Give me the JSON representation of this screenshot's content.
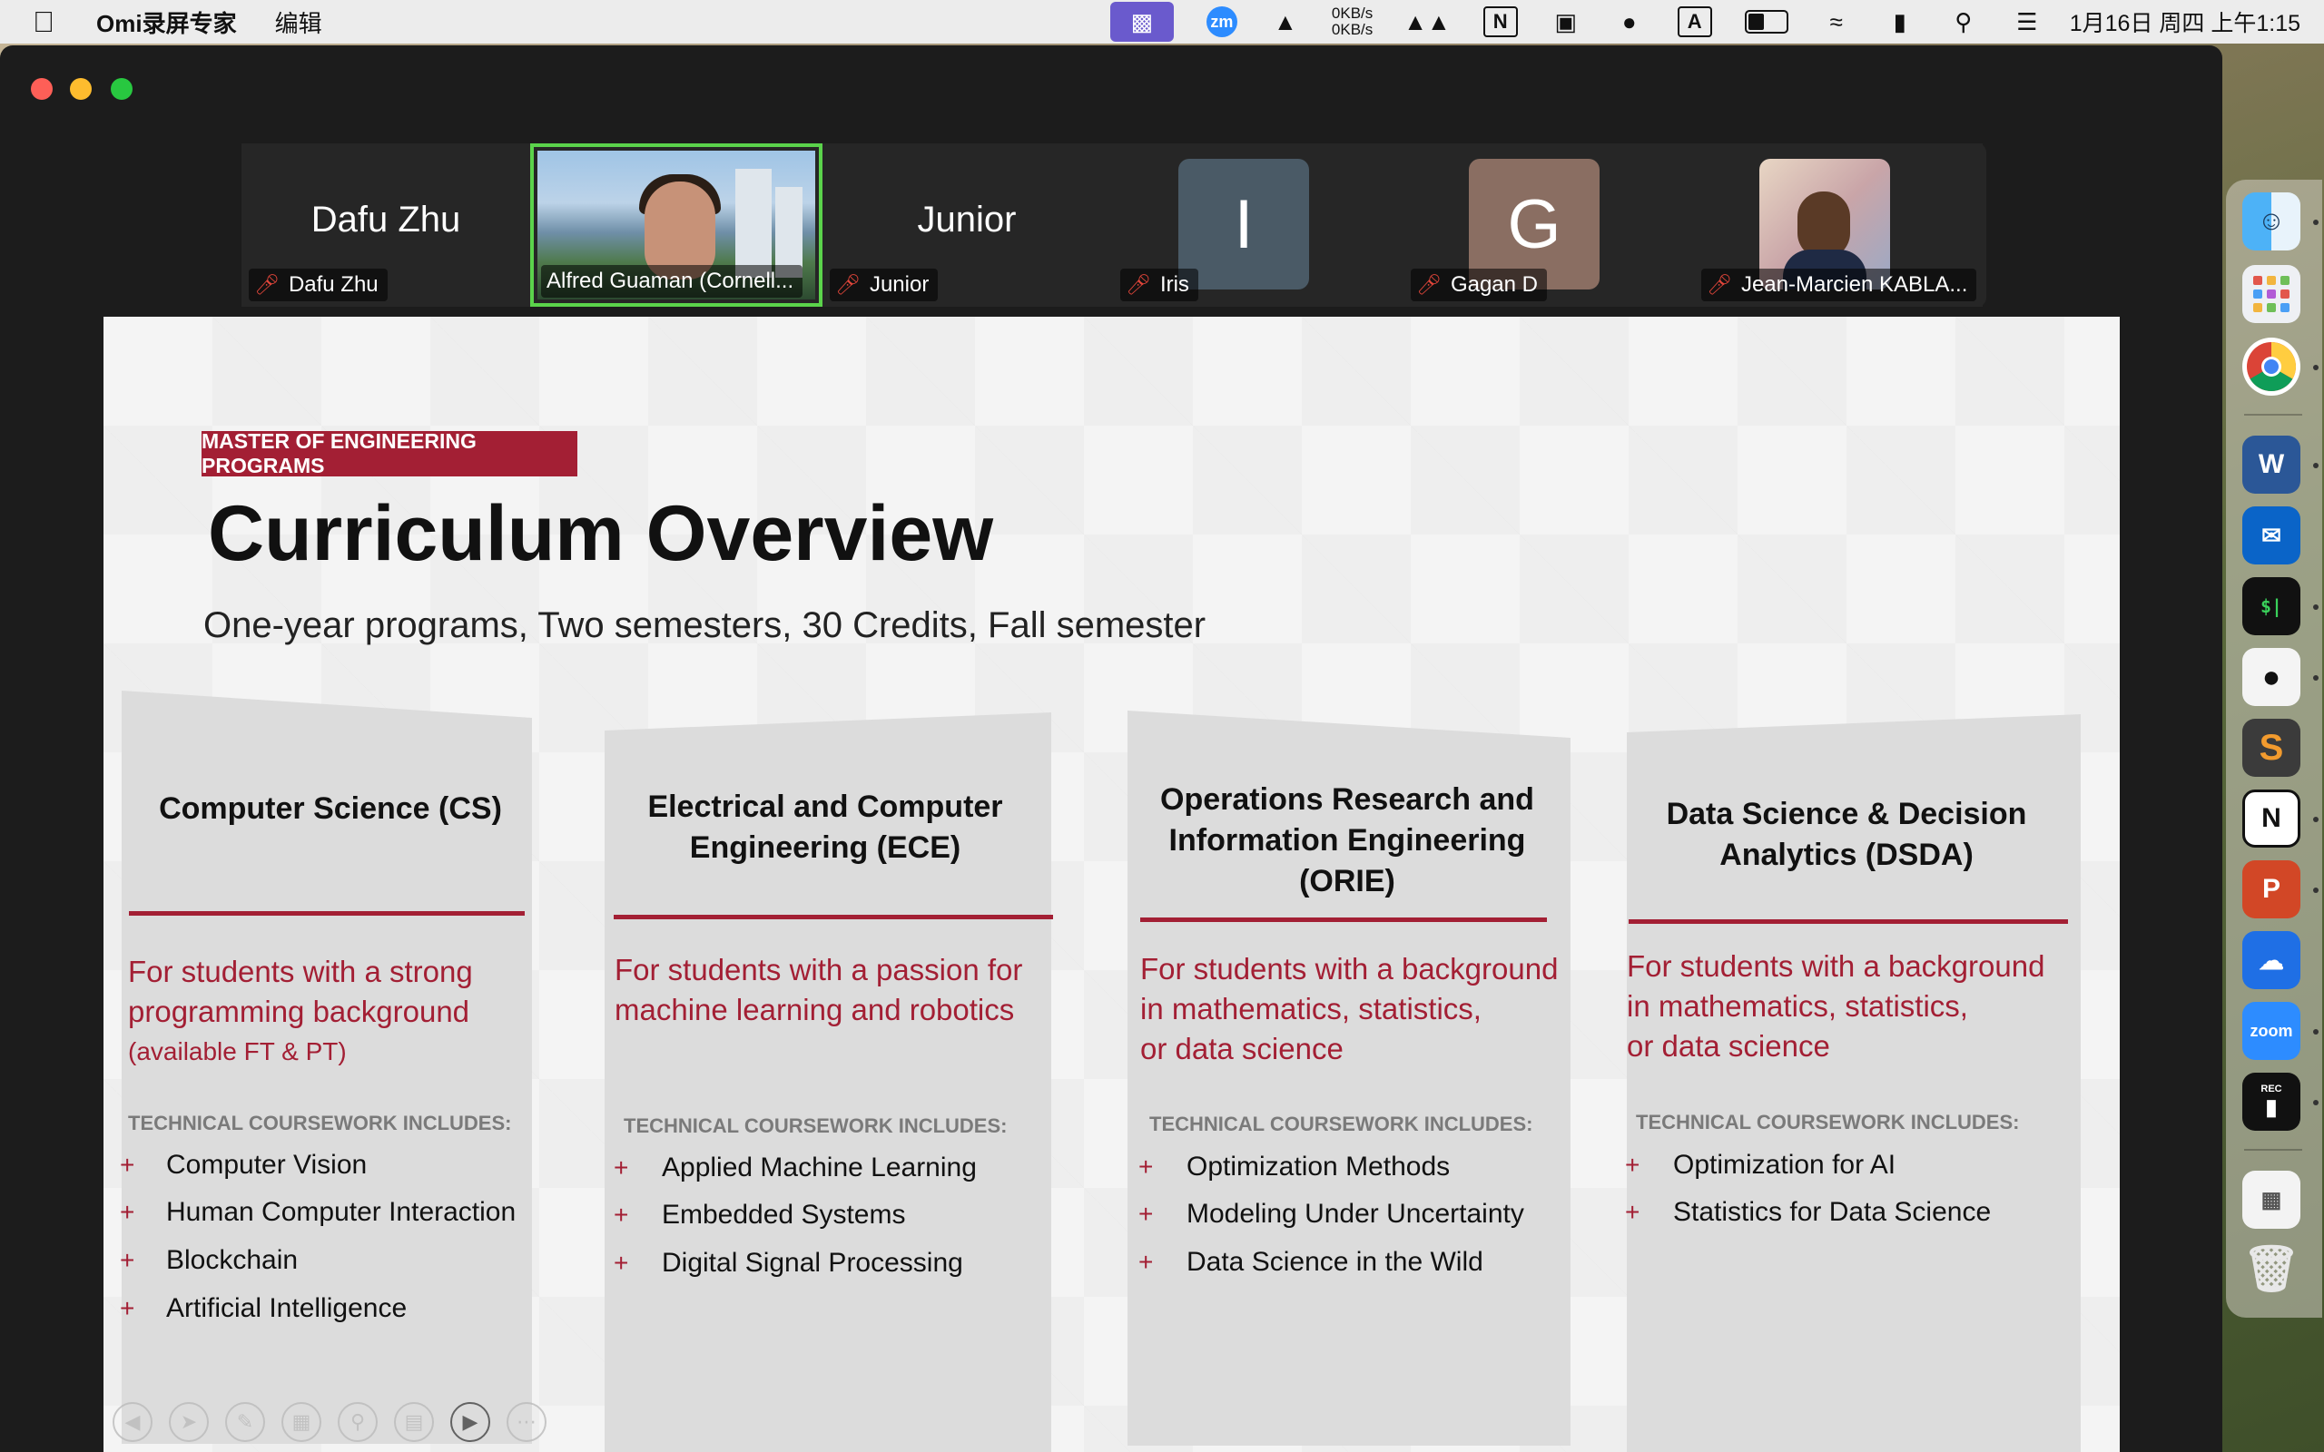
{
  "menubar": {
    "app_name": "Omi录屏专家",
    "menu_edit": "编辑",
    "network_up": "0KB/s",
    "network_down": "0KB/s",
    "zm_label": "zm",
    "notion_label": "N",
    "font_label": "A",
    "clock": "1月16日 周四  上午1:15"
  },
  "meeting": {
    "participants": [
      {
        "big_name": "Dafu Zhu",
        "label": "Dafu Zhu",
        "muted": true
      },
      {
        "big_name": "",
        "label": "Alfred Guaman (Cornell...",
        "muted": false,
        "video": true
      },
      {
        "big_name": "Junior",
        "label": "Junior",
        "muted": true
      },
      {
        "avatar_letter": "I",
        "label": "Iris",
        "muted": true,
        "avatar_color": "#4a5a66"
      },
      {
        "avatar_letter": "G",
        "label": "Gagan D",
        "muted": true,
        "avatar_color": "#8a6e62"
      },
      {
        "label": "Jean-Marcien KABLA...",
        "muted": true,
        "photo": true
      }
    ]
  },
  "slide": {
    "tag": "MASTER OF ENGINEERING PROGRAMS",
    "title": "Curriculum Overview",
    "subtitle": "One-year programs, Two semesters, 30 Credits, Fall semester",
    "accent_color": "#a31f34",
    "columns": [
      {
        "title_lines": [
          "Computer Science (CS)"
        ],
        "desc_lines": [
          "For students with a strong",
          "programming background"
        ],
        "desc_small": "(available FT & PT)",
        "coursework_heading": "TECHNICAL COURSEWORK INCLUDES:",
        "courses": [
          "Computer Vision",
          "Human Computer Interaction",
          "Blockchain",
          "Artificial Intelligence"
        ]
      },
      {
        "title_lines": [
          "Electrical and Computer",
          "Engineering (ECE)"
        ],
        "desc_lines": [
          "For students with a passion for",
          "machine learning and robotics"
        ],
        "coursework_heading": "TECHNICAL COURSEWORK INCLUDES:",
        "courses": [
          "Applied Machine Learning",
          "Embedded Systems",
          "Digital Signal Processing"
        ]
      },
      {
        "title_lines": [
          "Operations Research and",
          "Information Engineering",
          "(ORIE)"
        ],
        "desc_lines": [
          "For students with a background",
          "in mathematics, statistics,",
          "or data science"
        ],
        "coursework_heading": "TECHNICAL COURSEWORK INCLUDES:",
        "courses": [
          "Optimization Methods",
          "Modeling Under Uncertainty",
          "Data Science in the Wild"
        ]
      },
      {
        "title_lines": [
          "Data Science & Decision",
          "Analytics  (DSDA)"
        ],
        "desc_lines": [
          "For students with a background",
          "in mathematics, statistics,",
          "or data science"
        ],
        "coursework_heading": "TECHNICAL COURSEWORK INCLUDES:",
        "courses": [
          "Optimization for AI",
          "Statistics for Data Science"
        ]
      }
    ]
  },
  "dock": {
    "word_label": "W",
    "notion_label": "N",
    "ppt_label": "P",
    "zoom_label": "zoom",
    "terminal_label": "$|",
    "rec_label": "REC"
  }
}
